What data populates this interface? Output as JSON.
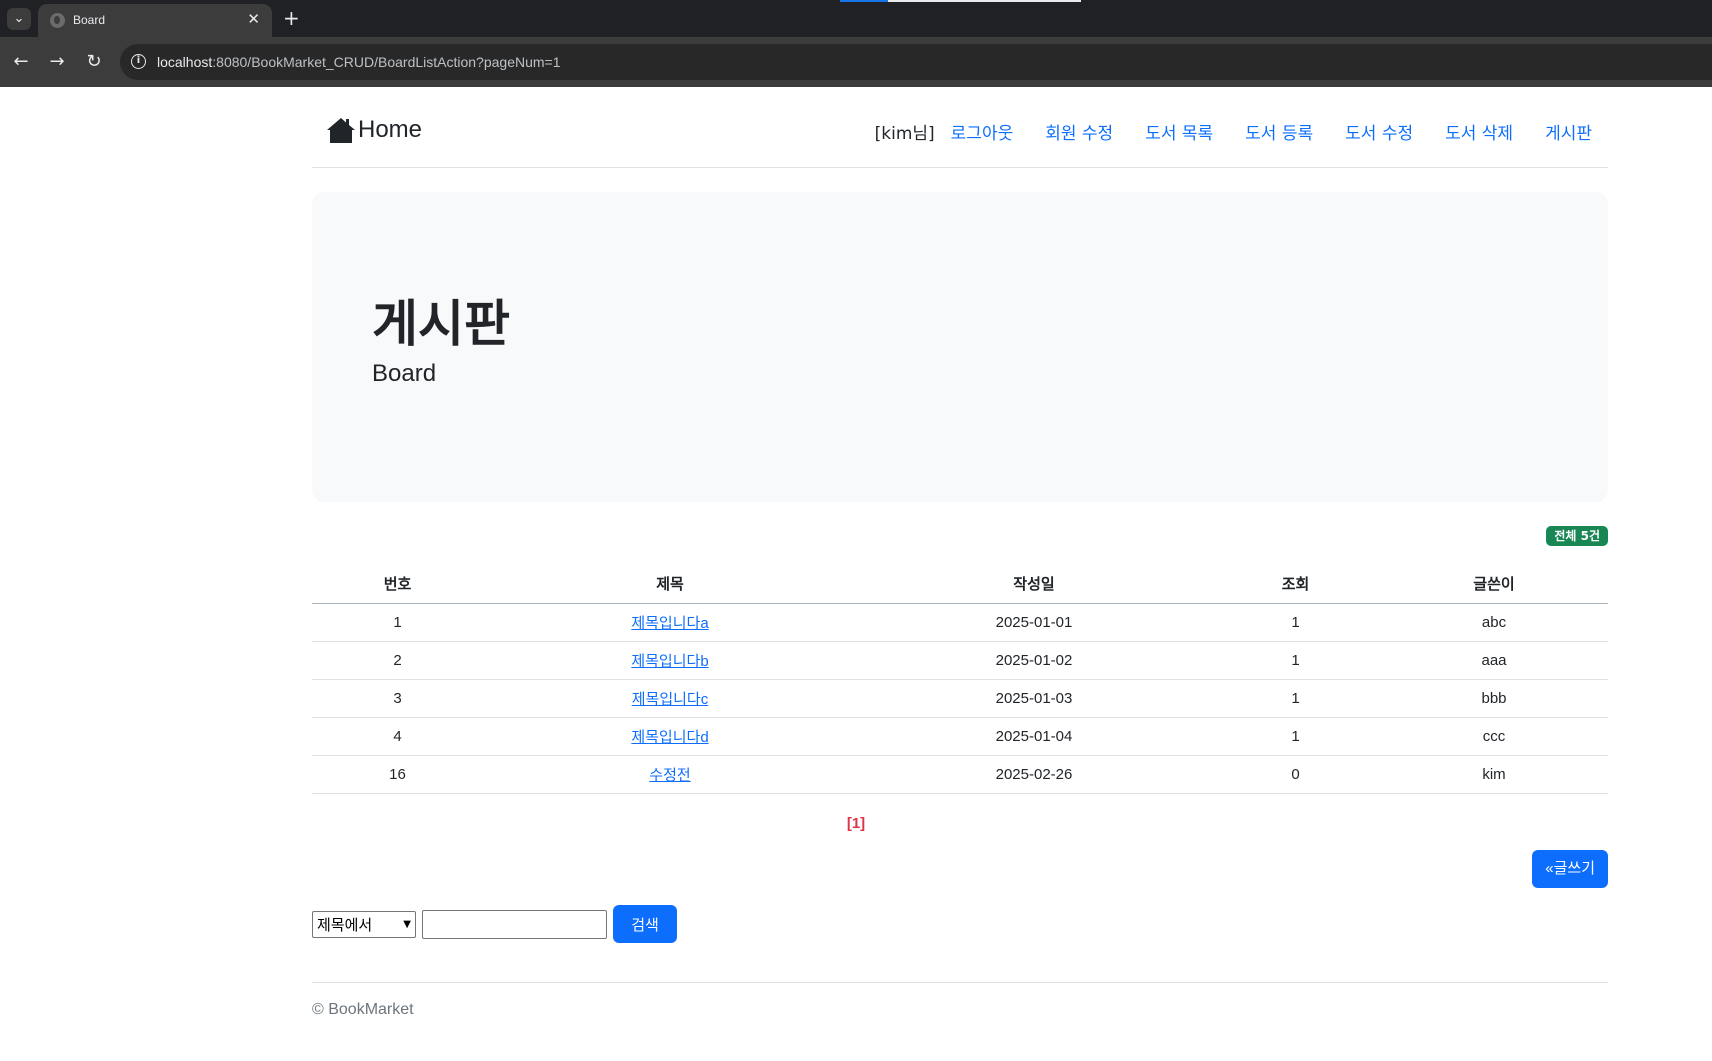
{
  "browser": {
    "tab_title": "Board",
    "tab_close": "✕",
    "new_tab": "+",
    "url_host": "localhost",
    "url_rest": ":8080/BookMarket_CRUD/BoardListAction?pageNum=1"
  },
  "header": {
    "home_label": "Home",
    "user_text": "[kim님]",
    "nav": [
      "로그아웃",
      "회원 수정",
      "도서 목록",
      "도서 등록",
      "도서 수정",
      "도서 삭제",
      "게시판"
    ]
  },
  "jumbotron": {
    "title": "게시판",
    "subtitle": "Board"
  },
  "board": {
    "total_badge": "전체 5건",
    "columns": [
      "번호",
      "제목",
      "작성일",
      "조회",
      "글쓴이"
    ],
    "rows": [
      {
        "num": "1",
        "subject": "제목입니다a",
        "date": "2025-01-01",
        "hit": "1",
        "writer": "abc"
      },
      {
        "num": "2",
        "subject": "제목입니다b",
        "date": "2025-01-02",
        "hit": "1",
        "writer": "aaa"
      },
      {
        "num": "3",
        "subject": "제목입니다c",
        "date": "2025-01-03",
        "hit": "1",
        "writer": "bbb"
      },
      {
        "num": "4",
        "subject": "제목입니다d",
        "date": "2025-01-04",
        "hit": "1",
        "writer": "ccc"
      },
      {
        "num": "16",
        "subject": "수정전",
        "date": "2025-02-26",
        "hit": "0",
        "writer": "kim"
      }
    ],
    "pager": "[1]",
    "write_button": "«글쓰기"
  },
  "search": {
    "selected": "제목에서",
    "input_value": "",
    "button": "검색"
  },
  "footer": {
    "text": "© BookMarket"
  }
}
